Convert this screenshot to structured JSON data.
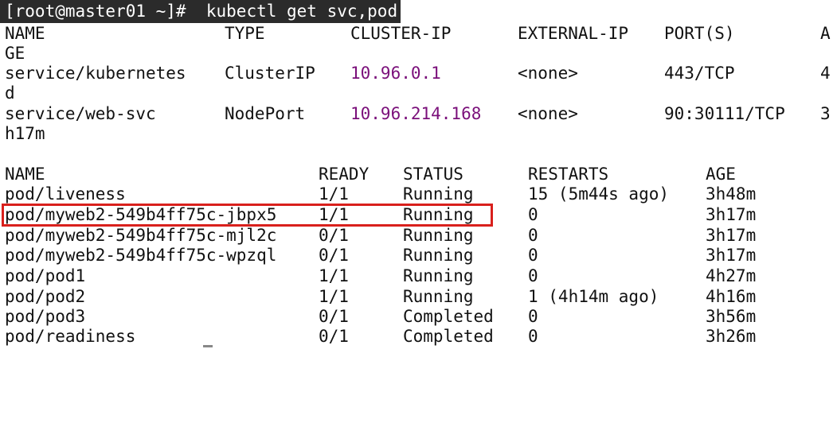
{
  "terminal": {
    "prompt": "[root@master01 ~]#",
    "command": "kubectl get svc,pod"
  },
  "services": {
    "headers": {
      "name": "NAME",
      "type": "TYPE",
      "cluster_ip": "CLUSTER-IP",
      "external_ip": "EXTERNAL-IP",
      "ports": "PORT(S)",
      "age_part1": "A",
      "age_part2": "GE"
    },
    "rows": [
      {
        "name": "service/kubernetes",
        "type": "ClusterIP",
        "cluster_ip": "10.96.0.1",
        "external_ip": "<none>",
        "ports": "443/TCP",
        "age_part1": "4",
        "age_part2": "d"
      },
      {
        "name": "service/web-svc",
        "type": "NodePort",
        "cluster_ip": "10.96.214.168",
        "external_ip": "<none>",
        "ports": "90:30111/TCP",
        "age_part1": "3",
        "age_part2": "h17m"
      }
    ]
  },
  "pods": {
    "headers": {
      "name": "NAME",
      "ready": "READY",
      "status": "STATUS",
      "restarts": "RESTARTS",
      "age": "AGE"
    },
    "rows": [
      {
        "name": "pod/liveness",
        "ready": "1/1",
        "status": "Running",
        "restarts": "15 (5m44s ago)",
        "age": "3h48m"
      },
      {
        "name": "pod/myweb2-549b4ff75c-jbpx5",
        "ready": "1/1",
        "status": "Running",
        "restarts": "0",
        "age": "3h17m"
      },
      {
        "name": "pod/myweb2-549b4ff75c-mjl2c",
        "ready": "0/1",
        "status": "Running",
        "restarts": "0",
        "age": "3h17m"
      },
      {
        "name": "pod/myweb2-549b4ff75c-wpzql",
        "ready": "0/1",
        "status": "Running",
        "restarts": "0",
        "age": "3h17m"
      },
      {
        "name": "pod/pod1",
        "ready": "1/1",
        "status": "Running",
        "restarts": "0",
        "age": "4h27m"
      },
      {
        "name": "pod/pod2",
        "ready": "1/1",
        "status": "Running",
        "restarts": "1 (4h14m ago)",
        "age": "4h16m"
      },
      {
        "name": "pod/pod3",
        "ready": "0/1",
        "status": "Completed",
        "restarts": "0",
        "age": "3h56m"
      },
      {
        "name": "pod/readiness",
        "ready": "0/1",
        "status": "Completed",
        "restarts": "0",
        "age": "3h26m"
      }
    ]
  },
  "highlight": {
    "color": "#d9201c",
    "row": "pod/myweb2-549b4ff75c-jbpx5"
  },
  "colors": {
    "ip_text": "#7a0f7a",
    "prompt_bg": "#2b2b2b"
  }
}
